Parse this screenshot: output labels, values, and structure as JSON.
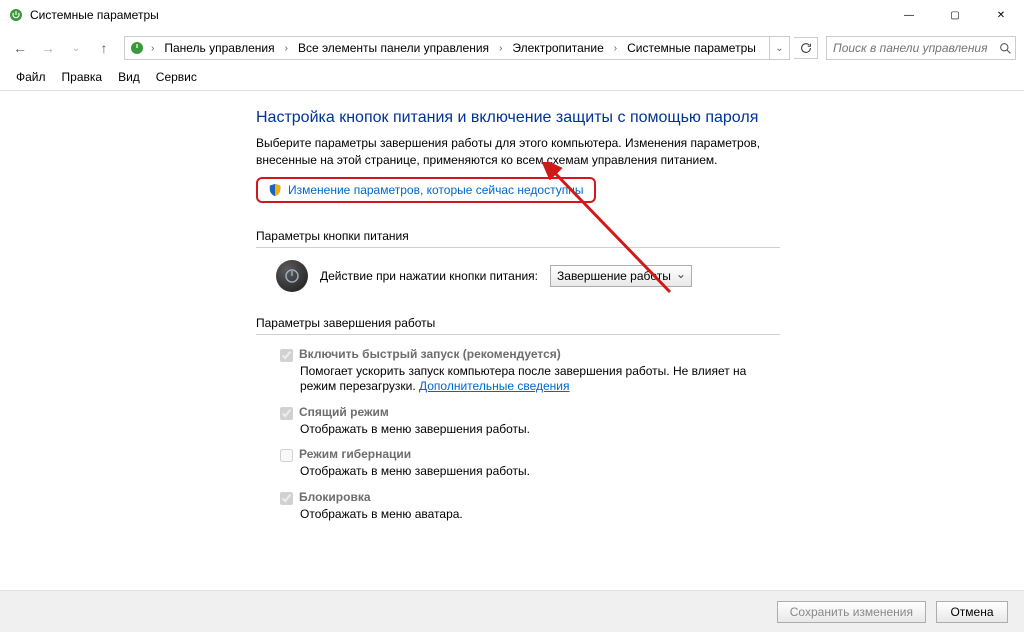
{
  "window": {
    "title": "Системные параметры"
  },
  "nav": {
    "breadcrumb": [
      "Панель управления",
      "Все элементы панели управления",
      "Электропитание",
      "Системные параметры"
    ],
    "search_placeholder": "Поиск в панели управления"
  },
  "menu": [
    "Файл",
    "Правка",
    "Вид",
    "Сервис"
  ],
  "main": {
    "heading": "Настройка кнопок питания и включение защиты с помощью пароля",
    "description": "Выберите параметры завершения работы для этого компьютера. Изменения параметров, внесенные на этой странице, применяются ко всем схемам управления питанием.",
    "change_link": "Изменение параметров, которые сейчас недоступны",
    "section_power_button": "Параметры кнопки питания",
    "power_action_label": "Действие при нажатии кнопки питания:",
    "power_action_value": "Завершение работы",
    "section_shutdown": "Параметры завершения работы",
    "options": [
      {
        "label": "Включить быстрый запуск (рекомендуется)",
        "desc": "Помогает ускорить запуск компьютера после завершения работы. Не влияет на режим перезагрузки. ",
        "more": "Дополнительные сведения",
        "checked": true,
        "disabled": true
      },
      {
        "label": "Спящий режим",
        "desc": "Отображать в меню завершения работы.",
        "checked": true,
        "disabled": true
      },
      {
        "label": "Режим гибернации",
        "desc": "Отображать в меню завершения работы.",
        "checked": false,
        "disabled": true
      },
      {
        "label": "Блокировка",
        "desc": "Отображать в меню аватара.",
        "checked": true,
        "disabled": true
      }
    ]
  },
  "footer": {
    "save": "Сохранить изменения",
    "cancel": "Отмена"
  }
}
